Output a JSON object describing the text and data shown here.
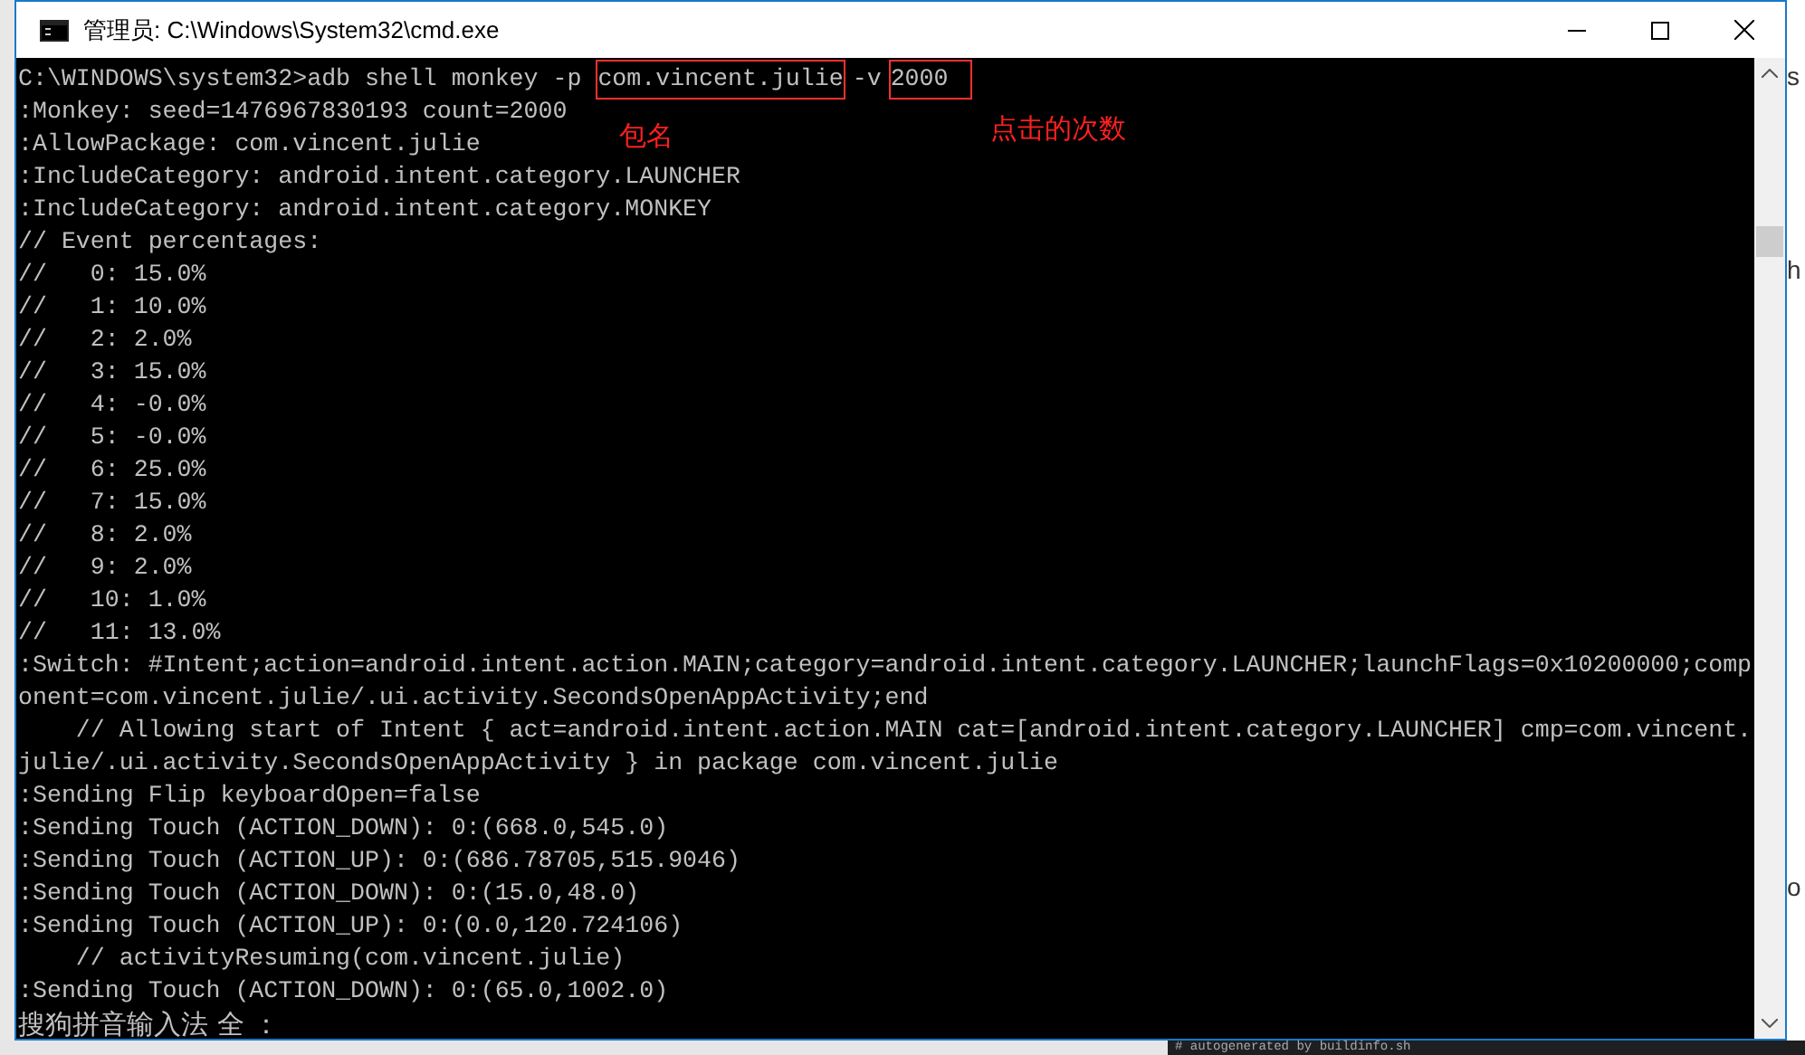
{
  "window": {
    "title": "管理员: C:\\Windows\\System32\\cmd.exe"
  },
  "command": {
    "prompt": "C:\\WINDOWS\\system32>adb shell monkey -p ",
    "package": "com.vincent.julie",
    "flag": "-v",
    "count": "2000"
  },
  "annotations": [
    {
      "kind": "package",
      "text": "包名"
    },
    {
      "kind": "count",
      "text": "点击的次数"
    }
  ],
  "lines": [
    ":Monkey: seed=1476967830193 count=2000",
    ":AllowPackage: com.vincent.julie",
    ":IncludeCategory: android.intent.category.LAUNCHER",
    ":IncludeCategory: android.intent.category.MONKEY",
    "// Event percentages:",
    "//   0: 15.0%",
    "//   1: 10.0%",
    "//   2: 2.0%",
    "//   3: 15.0%",
    "//   4: -0.0%",
    "//   5: -0.0%",
    "//   6: 25.0%",
    "//   7: 15.0%",
    "//   8: 2.0%",
    "//   9: 2.0%",
    "//   10: 1.0%",
    "//   11: 13.0%",
    ":Switch: #Intent;action=android.intent.action.MAIN;category=android.intent.category.LAUNCHER;launchFlags=0x10200000;comp",
    "onent=com.vincent.julie/.ui.activity.SecondsOpenAppActivity;end",
    "    // Allowing start of Intent { act=android.intent.action.MAIN cat=[android.intent.category.LAUNCHER] cmp=com.vincent.",
    "julie/.ui.activity.SecondsOpenAppActivity } in package com.vincent.julie",
    ":Sending Flip keyboardOpen=false",
    ":Sending Touch (ACTION_DOWN): 0:(668.0,545.0)",
    ":Sending Touch (ACTION_UP): 0:(686.78705,515.9046)",
    ":Sending Touch (ACTION_DOWN): 0:(15.0,48.0)",
    ":Sending Touch (ACTION_UP): 0:(0.0,120.724106)",
    "    // activityResuming(com.vincent.julie)",
    ":Sending Touch (ACTION_DOWN): 0:(65.0,1002.0)"
  ],
  "ime_status": "搜狗拼音输入法 全 ：",
  "background": {
    "right_fragments": [
      "s",
      "h",
      "o"
    ],
    "bottom_text": "# autogenerated by buildinfo.sh"
  }
}
